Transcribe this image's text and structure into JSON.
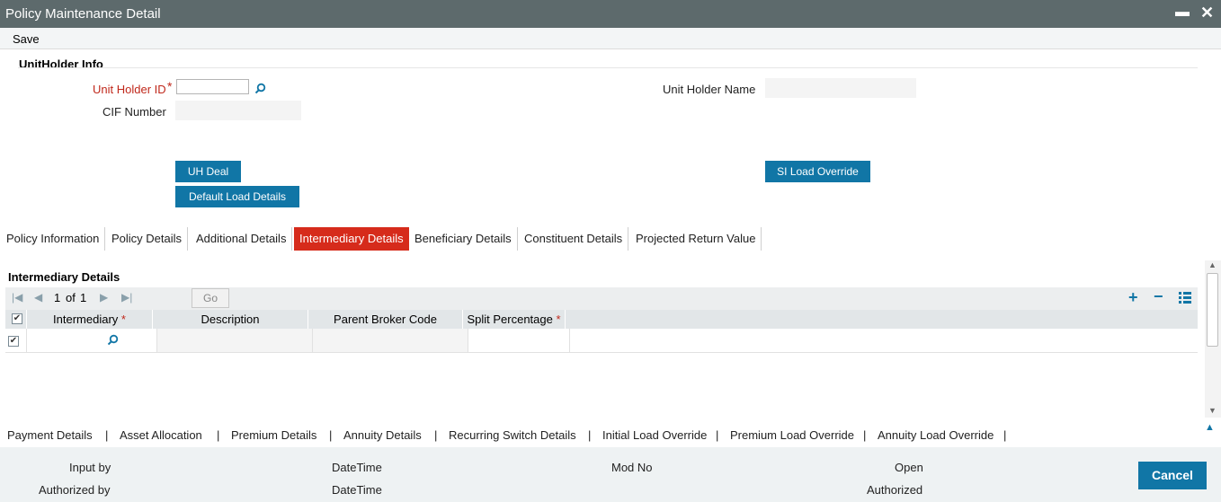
{
  "window": {
    "title": "Policy Maintenance Detail",
    "minimize": "▬",
    "close": "✕"
  },
  "menu": {
    "save": "Save"
  },
  "unitholder": {
    "section_title": "UnitHolder Info",
    "uh_id_label": "Unit Holder ID",
    "required_mark": "*",
    "uh_id_value": "",
    "uh_name_label": "Unit Holder Name",
    "uh_name_value": "",
    "cif_label": "CIF Number",
    "cif_value": ""
  },
  "buttons": {
    "uh_deal": "UH Deal",
    "default_load": "Default Load Details",
    "si_load": "SI Load Override"
  },
  "tabs": [
    "Policy Information",
    "Policy Details",
    "Additional Details",
    "Intermediary Details",
    "Beneficiary Details",
    "Constituent Details",
    "Projected Return Value"
  ],
  "active_tab": "Intermediary Details",
  "grid": {
    "title": "Intermediary Details",
    "page_current": "1",
    "page_of": "of",
    "page_total": "1",
    "go": "Go",
    "columns": [
      {
        "label": "Intermediary",
        "required": true
      },
      {
        "label": "Description",
        "required": false
      },
      {
        "label": "Parent Broker Code",
        "required": false
      },
      {
        "label": "Split Percentage",
        "required": true
      }
    ],
    "header_checked": true,
    "rows": [
      {
        "checked": true,
        "intermediary": "",
        "description": "",
        "parent_broker_code": "",
        "split_percentage": ""
      }
    ]
  },
  "bottom_links": [
    "Payment Details",
    "Asset Allocation",
    "Premium Details",
    "Annuity Details",
    "Recurring Switch Details",
    "Initial Load Override",
    "Premium Load Override",
    "Annuity Load Override"
  ],
  "separator": "|",
  "footer": {
    "input_by": "Input by",
    "authorized_by": "Authorized by",
    "datetime1": "DateTime",
    "datetime2": "DateTime",
    "mod_no": "Mod No",
    "open": "Open",
    "authorized": "Authorized",
    "cancel": "Cancel"
  },
  "colors": {
    "titlebar": "#5d6a6c",
    "accent": "#1176a6",
    "active_tab": "#d62b1b",
    "required": "#c0281b"
  }
}
